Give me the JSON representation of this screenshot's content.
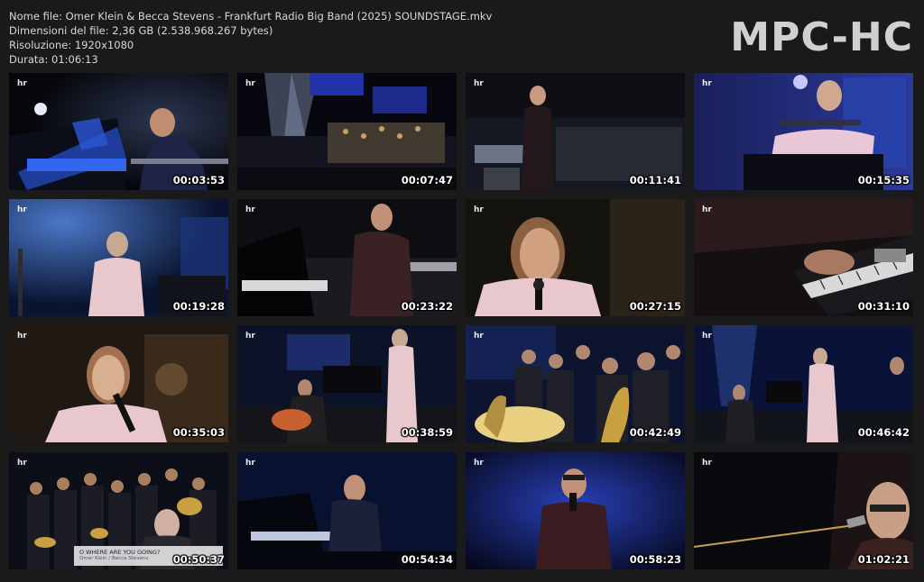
{
  "file_info": {
    "name": "Nome file: Omer Klein & Becca Stevens - Frankfurt Radio Big Band (2025) SOUNDSTAGE.mkv",
    "size": "Dimensioni del file: 2,36 GB (2.538.968.267 bytes)",
    "resolution": "Risoluzione: 1920x1080",
    "duration": "Durata: 01:06:13"
  },
  "logo": "MPC-HC",
  "network_bug": "hr",
  "thumbnails": [
    {
      "timestamp": "00:03:53"
    },
    {
      "timestamp": "00:07:47"
    },
    {
      "timestamp": "00:11:41"
    },
    {
      "timestamp": "00:15:35"
    },
    {
      "timestamp": "00:19:28"
    },
    {
      "timestamp": "00:23:22"
    },
    {
      "timestamp": "00:27:15"
    },
    {
      "timestamp": "00:31:10"
    },
    {
      "timestamp": "00:35:03"
    },
    {
      "timestamp": "00:38:59"
    },
    {
      "timestamp": "00:42:49"
    },
    {
      "timestamp": "00:46:42"
    },
    {
      "timestamp": "00:50:37"
    },
    {
      "timestamp": "00:54:34"
    },
    {
      "timestamp": "00:58:23"
    },
    {
      "timestamp": "01:02:21"
    }
  ],
  "lower_third": {
    "line1": "O WHERE ARE YOU GOING?",
    "line2": "Omer Klein / Becca Stevens"
  },
  "colors": {
    "background": "#1a1a1a",
    "text": "#d8d8d8",
    "logo": "#d0d0d0"
  }
}
